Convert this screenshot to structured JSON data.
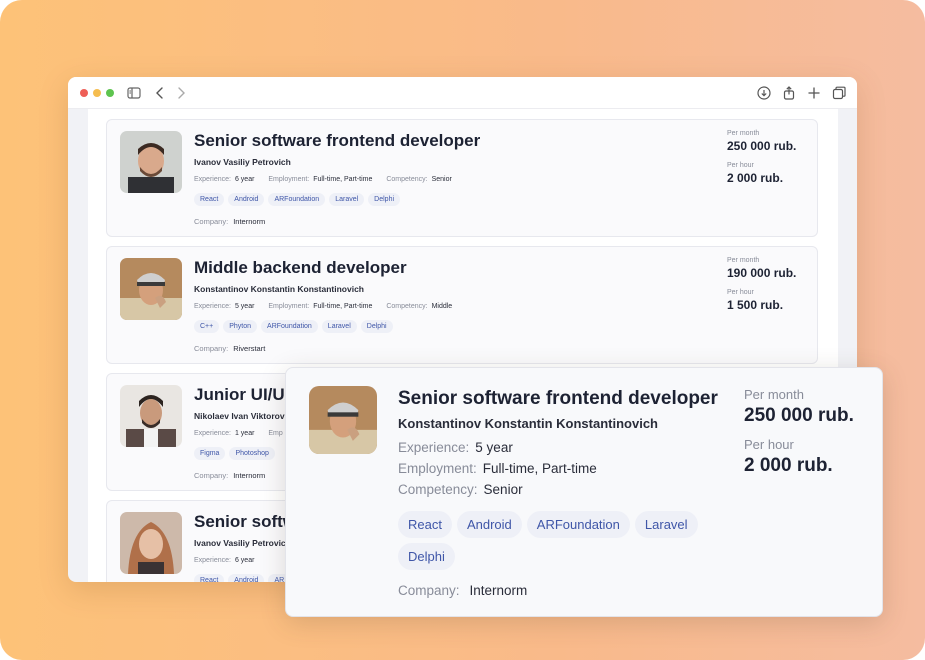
{
  "browser": {
    "icons": [
      "sidebar-icon",
      "back-icon",
      "forward-icon",
      "download-icon",
      "share-icon",
      "plus-icon",
      "tabs-icon"
    ]
  },
  "labels": {
    "experience": "Experience:",
    "employment": "Employment:",
    "competency": "Competency:",
    "company": "Company:",
    "per_month": "Per month",
    "per_hour": "Per hour"
  },
  "cards": [
    {
      "title": "Senior software frontend developer",
      "name": "Ivanov Vasiliy Petrovich",
      "experience": "6 year",
      "employment": "Full-time, Part-time",
      "competency": "Senior",
      "tags": [
        "React",
        "Android",
        "ARFoundation",
        "Laravel",
        "Delphi"
      ],
      "company": "Internorm",
      "per_month": "250 000 rub.",
      "per_hour": "2 000 rub."
    },
    {
      "title": "Middle backend developer",
      "name": "Konstantinov Konstantin Konstantinovich",
      "experience": "5 year",
      "employment": "Full-time, Part-time",
      "competency": "Middle",
      "tags": [
        "C++",
        "Phyton",
        "ARFoundation",
        "Laravel",
        "Delphi"
      ],
      "company": "Riverstart",
      "per_month": "190 000 rub.",
      "per_hour": "1 500 rub."
    },
    {
      "title": "Junior UI/UX",
      "name": "Nikolaev Ivan Viktorov",
      "experience": "1 year",
      "employment": "Emp",
      "competency": "",
      "tags": [
        "Figma",
        "Photoshop"
      ],
      "company": "Internorm",
      "per_month": "",
      "per_hour": ""
    },
    {
      "title": "Senior softw",
      "name": "Ivanov Vasiliy Petrovich",
      "experience": "6 year",
      "employment": "",
      "competency": "",
      "tags": [
        "React",
        "Android",
        "AR"
      ],
      "company": "",
      "per_month": "",
      "per_hour": ""
    }
  ],
  "popup": {
    "title": "Senior software frontend developer",
    "name": "Konstantinov Konstantin Konstantinovich",
    "experience": "5 year",
    "employment": "Full-time, Part-time",
    "competency": "Senior",
    "tags": [
      "React",
      "Android",
      "ARFoundation",
      "Laravel",
      "Delphi"
    ],
    "company": "Internorm",
    "per_month": "250 000 rub.",
    "per_hour": "2 000 rub."
  },
  "colors": {
    "accent_tag_text": "#3f56a8",
    "tag_bg": "#eef0f7",
    "traffic_red": "#ee5f57",
    "traffic_yellow": "#f5bd4f",
    "traffic_green": "#5ec44f"
  }
}
